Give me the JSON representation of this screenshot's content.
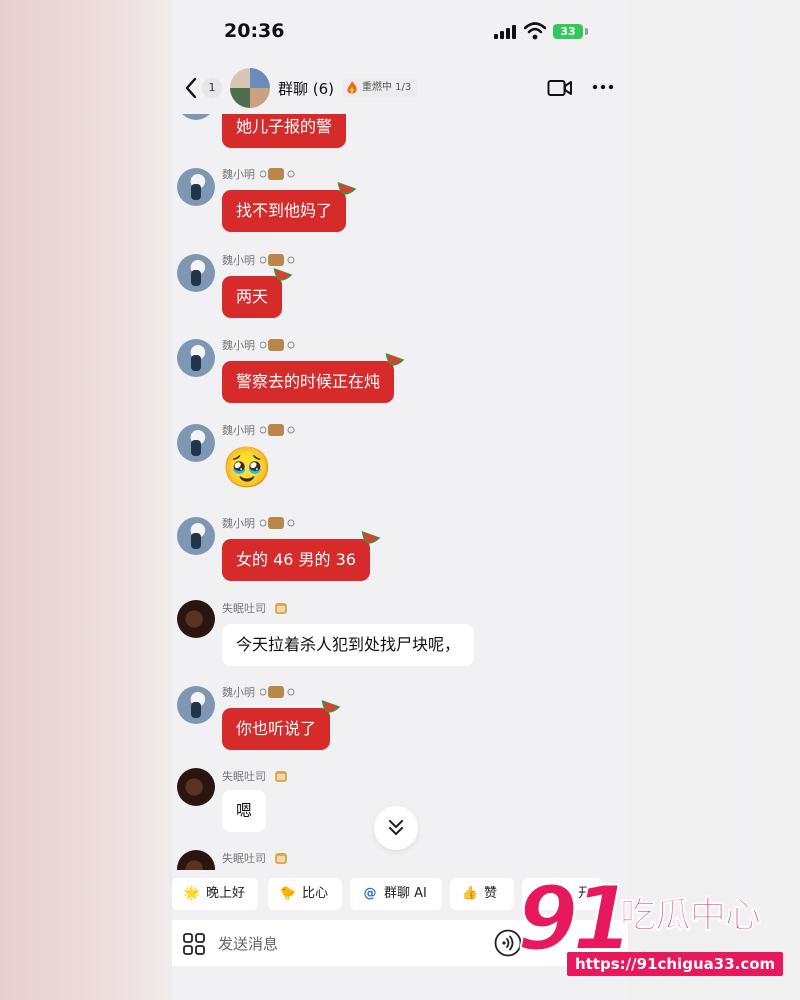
{
  "status_bar": {
    "time": "20:36",
    "battery": "33"
  },
  "header": {
    "unread_count": "1",
    "title": "群聊 (6)",
    "heat_label": "重燃中 1/3"
  },
  "messages": [
    {
      "sender": "",
      "type": "text",
      "style": "red",
      "text": "她儿子报的警"
    },
    {
      "sender": "魏小明",
      "type": "text",
      "style": "red",
      "text": "找不到他妈了"
    },
    {
      "sender": "魏小明",
      "type": "text",
      "style": "red",
      "text": "两天"
    },
    {
      "sender": "魏小明",
      "type": "text",
      "style": "red",
      "text": "警察去的时候正在炖"
    },
    {
      "sender": "魏小明",
      "type": "emoji",
      "text": "🥹"
    },
    {
      "sender": "魏小明",
      "type": "text",
      "style": "red",
      "text": "女的 46 男的 36"
    },
    {
      "sender": "失眠吐司",
      "type": "text",
      "style": "white",
      "text": "今天拉着杀人犯到处找尸块呢，"
    },
    {
      "sender": "魏小明",
      "type": "text",
      "style": "red",
      "text": "你也听说了"
    },
    {
      "sender": "失眠吐司",
      "type": "text",
      "style": "white",
      "text": "嗯"
    },
    {
      "sender": "失眠吐司",
      "type": "partial",
      "text": ""
    }
  ],
  "quick_replies": [
    {
      "icon": "🌟",
      "label": "晚上好"
    },
    {
      "icon": "🐤",
      "label": "比心"
    },
    {
      "icon": "@",
      "label": "群聊 AI"
    },
    {
      "icon": "👍",
      "label": "赞"
    },
    {
      "icon": "",
      "label": "开"
    }
  ],
  "input": {
    "placeholder": "发送消息"
  },
  "watermark": {
    "number": "91",
    "name": "吃瓜中心",
    "url": "https://91chigua33.com"
  },
  "colors": {
    "red_bubble": "#d62a2b",
    "watermark": "#e8185d",
    "battery": "#34c759"
  }
}
